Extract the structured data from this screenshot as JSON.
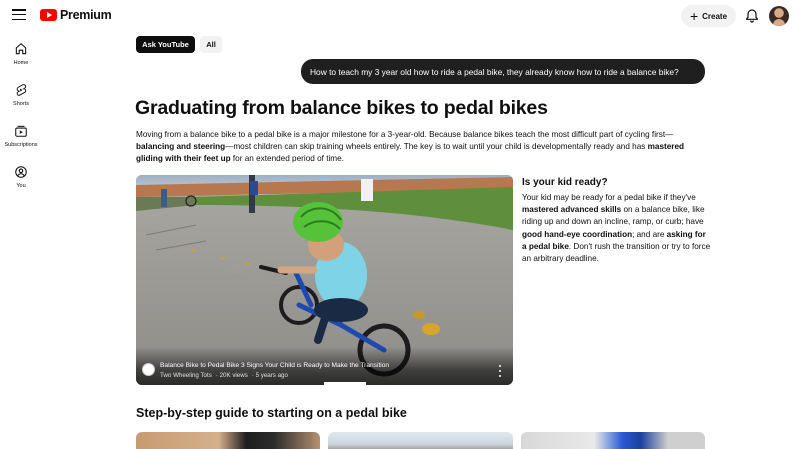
{
  "app": {
    "logo_text": "Premium",
    "brand_color": "#ff0000"
  },
  "topbar": {
    "create_label": "Create",
    "icons": [
      "menu-icon",
      "bell-icon",
      "avatar"
    ]
  },
  "sidebar": {
    "items": [
      {
        "label": "Home",
        "icon": "home-icon"
      },
      {
        "label": "Shorts",
        "icon": "shorts-icon"
      },
      {
        "label": "Subscriptions",
        "icon": "subscriptions-icon"
      },
      {
        "label": "You",
        "icon": "you-icon"
      }
    ]
  },
  "chips": {
    "active": "Ask YouTube",
    "all": "All"
  },
  "query": "How to teach my 3 year old how to ride a pedal bike, they already know how to ride a balance bike?",
  "article": {
    "title": "Graduating from balance bikes to pedal bikes",
    "intro": {
      "p1": "Moving from a balance bike to a pedal bike is a major milestone for a 3-year-old. Because balance bikes teach the most difficult part of cycling first—",
      "b1": "balancing and steering",
      "p2": "—most children can skip training wheels entirely. The key is to wait until your child is developmentally ready and has ",
      "b2": "mastered gliding with their feet up",
      "p3": " for an extended period of time."
    }
  },
  "video": {
    "title": "Balance Bike to Pedal Bike 3 Signs Your Child is Ready to Make the Transition",
    "channel": "Two Wheeling Tots",
    "views": "20K views",
    "age": "5 years ago",
    "progress": 0.14
  },
  "ready_card": {
    "title": "Is your kid ready?",
    "t1": "Your kid may be ready for a pedal bike if they've ",
    "b1": "mastered advanced skills",
    "t2": " on a balance bike, like riding up and down an incline, ramp, or curb; have ",
    "b2": "good hand-eye coordination",
    "t3": "; and are ",
    "b3": "asking for a pedal bike",
    "t4": ". Don't rush the transition or try to force an arbitrary deadline."
  },
  "guide": {
    "title": "Step-by-step guide to starting on a pedal bike"
  }
}
